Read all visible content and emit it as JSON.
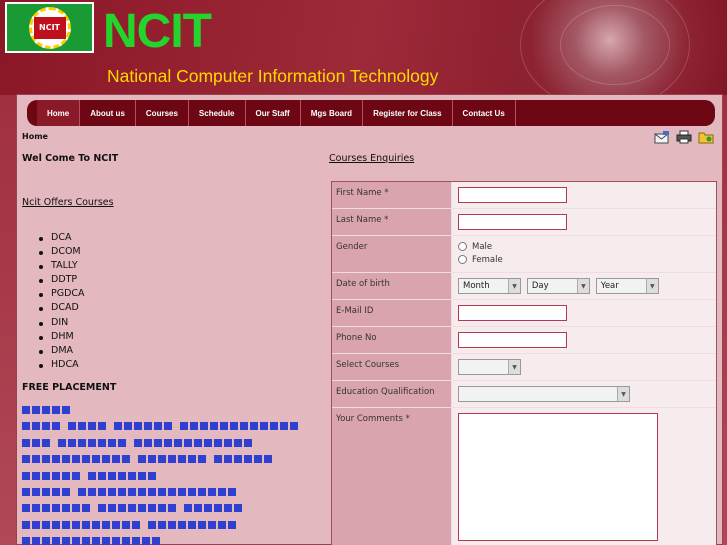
{
  "header": {
    "logo_text": "NCIT",
    "brand": "NCIT",
    "tagline": "National Computer Information Technology"
  },
  "nav": {
    "items": [
      {
        "label": "Home"
      },
      {
        "label": "About us"
      },
      {
        "label": "Courses"
      },
      {
        "label": "Schedule"
      },
      {
        "label": "Our Staff"
      },
      {
        "label": "Mgs Board"
      },
      {
        "label": "Register for Class"
      },
      {
        "label": "Contact Us"
      }
    ],
    "active": "Home"
  },
  "breadcrumb": "Home",
  "tools": [
    "email-icon",
    "print-icon",
    "folder-icon"
  ],
  "left": {
    "welcome": "Wel Come To NCIT",
    "offers_link": "Ncit Offers Courses",
    "courses": [
      "DCA",
      "DCOM",
      "TALLY",
      "DDTP",
      "PGDCA",
      "DCAD",
      "DIN",
      "DHM",
      "DMA",
      "HDCA"
    ],
    "placement": "FREE PLACEMENT"
  },
  "form": {
    "title": "Courses Enquiries",
    "first_name": "First Name *",
    "last_name": "Last Name *",
    "gender": "Gender",
    "male": "Male",
    "female": "Female",
    "dob": "Date of birth",
    "month": "Month",
    "day": "Day",
    "year": "Year",
    "email": "E-Mail ID",
    "phone": "Phone No",
    "select_courses": "Select Courses",
    "education": "Education Qualification",
    "comments": "Your Comments *"
  },
  "colors": {
    "brand_green": "#22d42b",
    "tagline_yellow": "#ffd800",
    "nav_bg": "#6e0714",
    "page_bg": "#e3b8bf"
  }
}
